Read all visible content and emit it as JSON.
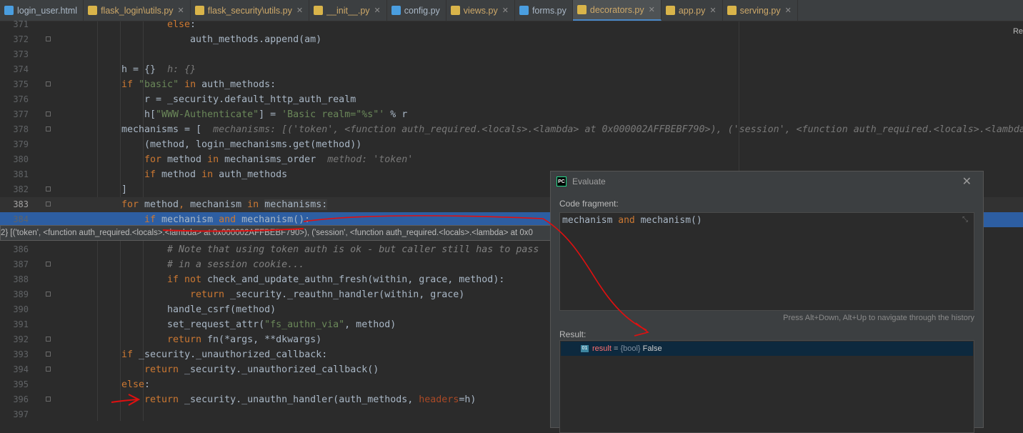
{
  "tabs": [
    {
      "label": "login_user.html",
      "color": "#4a9ee0",
      "active": false,
      "close": false
    },
    {
      "label": "flask_login\\utils.py",
      "color": "#d9b44a",
      "active": false,
      "close": true
    },
    {
      "label": "flask_security\\utils.py",
      "color": "#d9b44a",
      "active": false,
      "close": true
    },
    {
      "label": "__init__.py",
      "color": "#d9b44a",
      "active": false,
      "close": true
    },
    {
      "label": "config.py",
      "color": "#4a9ee0",
      "active": false,
      "close": false
    },
    {
      "label": "views.py",
      "color": "#d9b44a",
      "active": false,
      "close": true
    },
    {
      "label": "forms.py",
      "color": "#4a9ee0",
      "active": false,
      "close": false
    },
    {
      "label": "decorators.py",
      "color": "#d9b44a",
      "active": true,
      "close": true
    },
    {
      "label": "app.py",
      "color": "#d9b44a",
      "active": false,
      "close": true
    },
    {
      "label": "serving.py",
      "color": "#d9b44a",
      "active": false,
      "close": true
    }
  ],
  "right_label": "Re",
  "lines": {
    "l371": {
      "num": "371",
      "a": "else",
      "b": ":"
    },
    "l372": {
      "num": "372",
      "a": "auth_methods.append(am)"
    },
    "l373": {
      "num": "373"
    },
    "l374": {
      "num": "374",
      "a": "h = {}",
      "hint": "h: {}"
    },
    "l375": {
      "num": "375",
      "kw1": "if ",
      "s1": "\"basic\"",
      "kw2": " in ",
      "a": "auth_methods:"
    },
    "l376": {
      "num": "376",
      "a": "r = _security.default_http_auth_realm"
    },
    "l377": {
      "num": "377",
      "a": "h[",
      "s1": "\"WWW-Authenticate\"",
      "b": "] = ",
      "s2": "'Basic realm=\"%s\"'",
      "c": " % r"
    },
    "l378": {
      "num": "378",
      "a": "mechanisms = [",
      "hint": "mechanisms: [('token', <function auth_required.<locals>.<lambda> at 0x000002AFFBEBF790>), ('session', <function auth_required.<locals>.<lambda"
    },
    "l379": {
      "num": "379",
      "a": "(method, login_mechanisms.get(method))"
    },
    "l380": {
      "num": "380",
      "kw1": "for ",
      "a": "method ",
      "kw2": "in ",
      "b": "mechanisms_order",
      "hint": "method: 'token'"
    },
    "l381": {
      "num": "381",
      "kw1": "if ",
      "a": "method ",
      "kw2": "in ",
      "b": "auth_methods"
    },
    "l382": {
      "num": "382",
      "a": "]"
    },
    "l383": {
      "num": "383",
      "kw1": "for ",
      "a": "method",
      "k3": ", ",
      "b": "mechanism ",
      "kw2": "in ",
      "c": "mechanisms:"
    },
    "l384": {
      "num": "384",
      "kw1": "if ",
      "a": "mechanism ",
      "kw2": "and ",
      "b": "mechanism():"
    },
    "l386": {
      "num": "386",
      "cm": "# Note that using token auth is ok - but caller still has to pass"
    },
    "l387": {
      "num": "387",
      "cm": "# in a session cookie..."
    },
    "l388": {
      "num": "388",
      "kw1": "if not ",
      "a": "check_and_update_authn_fresh(within, grace, method):"
    },
    "l389": {
      "num": "389",
      "kw1": "return ",
      "a": "_security._reauthn_handler(within, grace)"
    },
    "l390": {
      "num": "390",
      "a": "handle_csrf(method)"
    },
    "l391": {
      "num": "391",
      "a": "set_request_attr(",
      "s1": "\"fs_authn_via\"",
      "b": ", method)"
    },
    "l392": {
      "num": "392",
      "kw1": "return ",
      "a": "fn(*args, **dkwargs)"
    },
    "l393": {
      "num": "393",
      "kw1": "if ",
      "a": "_security._unauthorized_callback:"
    },
    "l394": {
      "num": "394",
      "kw1": "return ",
      "a": "_security._unauthorized_callback()"
    },
    "l395": {
      "num": "395",
      "kw1": "else",
      "a": ":"
    },
    "l396": {
      "num": "396",
      "kw1": "return ",
      "a": "_security._unauthn_handler(auth_methods, ",
      "p": "headers",
      "b": "=h)"
    },
    "l397": {
      "num": "397"
    }
  },
  "tooltip": "2} [('token', <function auth_required.<locals>.<lambda> at 0x000002AFFBEBF790>), ('session', <function auth_required.<locals>.<lambda> at 0x0",
  "dialog": {
    "title": "Evaluate",
    "code_label": "Code fragment:",
    "fragment": {
      "a": "mechanism ",
      "kw": "and ",
      "b": "mechanism()"
    },
    "history_hint": "Press Alt+Down, Alt+Up to navigate through the history",
    "result_label": "Result:",
    "result": {
      "name": "result",
      "eq": " = ",
      "type": "{bool}",
      "value": " False",
      "icon": "01"
    }
  },
  "colors": {
    "accent": "#4a88c7",
    "annotation": "#e01010"
  }
}
